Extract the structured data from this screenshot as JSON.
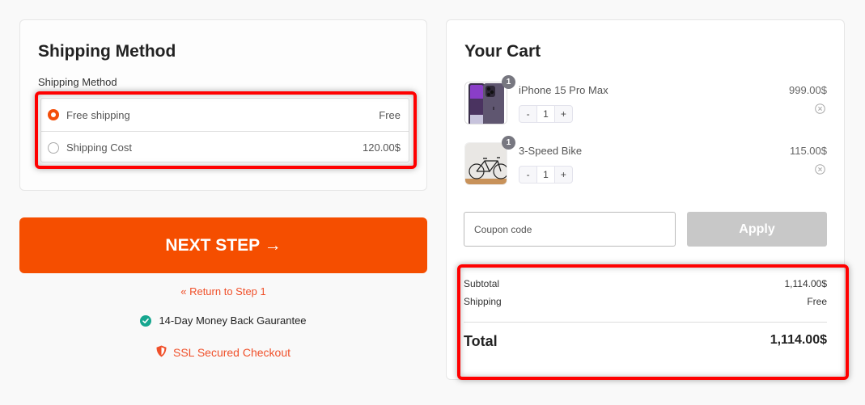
{
  "shipping": {
    "title": "Shipping Method",
    "field_label": "Shipping Method",
    "options": [
      {
        "label": "Free shipping",
        "price": "Free",
        "selected": true
      },
      {
        "label": "Shipping Cost",
        "price": "120.00$",
        "selected": false
      }
    ]
  },
  "actions": {
    "next_step_label": "NEXT STEP →",
    "return_link": "« Return to Step 1",
    "guarantee": "14-Day Money Back Gaurantee",
    "ssl": "SSL Secured Checkout"
  },
  "cart": {
    "title": "Your Cart",
    "items": [
      {
        "name": "iPhone 15 Pro Max",
        "price": "999.00$",
        "quantity": "1",
        "badge": "1",
        "image": "iphone-image"
      },
      {
        "name": "3-Speed Bike",
        "price": "115.00$",
        "quantity": "1",
        "badge": "1",
        "image": "bike-image"
      }
    ],
    "stepper": {
      "minus": "-",
      "plus": "+"
    },
    "coupon_placeholder": "Coupon code",
    "apply_label": "Apply",
    "summary": {
      "subtotal_label": "Subtotal",
      "subtotal_value": "1,114.00$",
      "shipping_label": "Shipping",
      "shipping_value": "Free",
      "total_label": "Total",
      "total_value": "1,114.00$"
    }
  },
  "colors": {
    "accent": "#f54e00",
    "link": "#f0502a",
    "success": "#16a68f",
    "apply_disabled": "#c8c8c8",
    "highlight": "#ff0000"
  }
}
